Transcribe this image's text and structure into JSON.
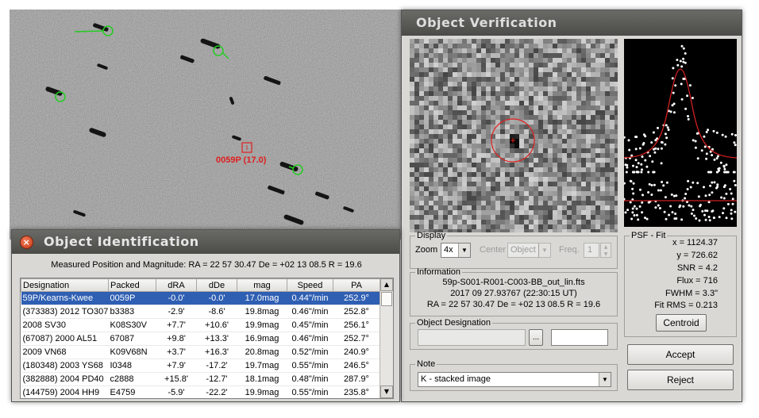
{
  "colors": {
    "accent_red": "#e02020",
    "marker_green": "#22cc22",
    "selection": "#2f5fb3"
  },
  "starfield": {
    "target_label": "0059P (17.0)"
  },
  "verification": {
    "title": "Object Verification",
    "display": {
      "legend": "Display",
      "zoom_label": "Zoom",
      "zoom_value": "4x",
      "center_label": "Center",
      "center_value": "Object",
      "freq_label": "Freq.",
      "freq_value": "1"
    },
    "information": {
      "legend": "Information",
      "filename": "59p-S001-R001-C003-BB_out_lin.fts",
      "datetime": "2017 09 27.93767 (22:30:15 UT)",
      "position": "RA = 22 57 30.47   De = +02 13 08.5   R = 19.6"
    },
    "object_designation": {
      "legend": "Object Designation",
      "browse_label": "...",
      "value": ""
    },
    "note": {
      "legend": "Note",
      "value": "K - stacked image"
    },
    "psf": {
      "legend": "PSF - Fit",
      "lines": [
        "x = 1124.37",
        "y = 726.62",
        "SNR = 4.2",
        "Flux = 716",
        "FWHM = 3.3\"",
        "Fit RMS = 0.213"
      ],
      "centroid_label": "Centroid"
    },
    "accept_label": "Accept",
    "reject_label": "Reject"
  },
  "identification": {
    "title": "Object Identification",
    "close_glyph": "×",
    "measured": "Measured Position and Magnitude: RA = 22 57 30.47   De = +02 13 08.5   R = 19.6",
    "columns": [
      "Designation",
      "Packed",
      "dRA",
      "dDe",
      "mag",
      "Speed",
      "PA"
    ],
    "rows": [
      [
        "59P/Kearns-Kwee",
        "0059P",
        "-0.0'",
        "-0.0'",
        "17.0mag",
        "0.44\"/min",
        "252.9°"
      ],
      [
        "(373383) 2012 TO307",
        "b3383",
        "-2.9'",
        "-8.6'",
        "19.8mag",
        "0.46\"/min",
        "252.8°"
      ],
      [
        "2008 SV30",
        "K08S30V",
        "+7.7'",
        "+10.6'",
        "19.9mag",
        "0.45\"/min",
        "256.1°"
      ],
      [
        "(67087) 2000 AL51",
        "67087",
        "+9.8'",
        "+13.3'",
        "16.9mag",
        "0.46\"/min",
        "252.7°"
      ],
      [
        "2009 VN68",
        "K09V68N",
        "+3.7'",
        "+16.3'",
        "20.8mag",
        "0.52\"/min",
        "240.9°"
      ],
      [
        "(180348) 2003 YS68",
        "I0348",
        "+7.9'",
        "-17.2'",
        "19.7mag",
        "0.55\"/min",
        "246.5°"
      ],
      [
        "(382888) 2004 PD40",
        "c2888",
        "+15.8'",
        "-12.7'",
        "18.1mag",
        "0.48\"/min",
        "287.9°"
      ],
      [
        "(144759) 2004 HH9",
        "E4759",
        "-5.9'",
        "-22.2'",
        "19.9mag",
        "0.55\"/min",
        "235.8°"
      ]
    ]
  }
}
